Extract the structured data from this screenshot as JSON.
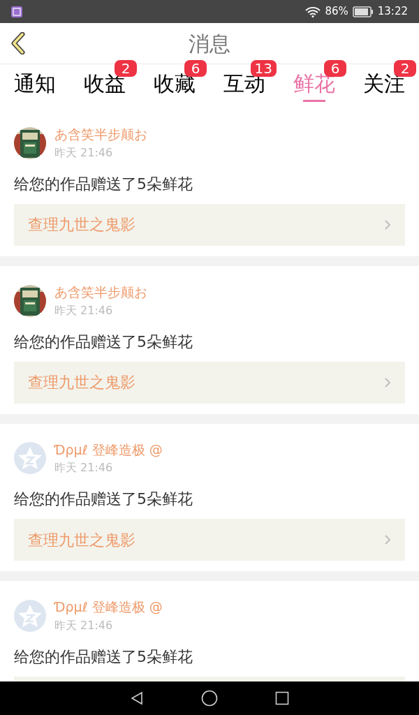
{
  "status_bar": {
    "battery": "86%",
    "time": "13:22"
  },
  "header": {
    "title": "消息"
  },
  "tabs": [
    {
      "label": "通知",
      "selected": false
    },
    {
      "label": "收益",
      "badge": "2",
      "selected": false
    },
    {
      "label": "收藏",
      "badge": "6",
      "selected": false
    },
    {
      "label": "互动",
      "badge": "13",
      "selected": false
    },
    {
      "label": "鲜花",
      "badge": "6",
      "selected": true
    },
    {
      "label": "关注",
      "badge": "2",
      "selected": false
    }
  ],
  "messages": [
    {
      "user": "あ含笑半步颠お",
      "time": "昨天 21:46",
      "text": "给您的作品赠送了5朵鲜花",
      "link": "查理九世之鬼影"
    },
    {
      "user": "あ含笑半步颠お",
      "time": "昨天 21:46",
      "text": "给您的作品赠送了5朵鲜花",
      "link": "查理九世之鬼影"
    },
    {
      "avatar": {
        "kind": "default"
      },
      "user": "Ɗρμℓ 登峰造极 @",
      "time": "昨天 21:46",
      "text": "给您的作品赠送了5朵鲜花",
      "link": "查理九世之鬼影"
    },
    {
      "avatar": {
        "kind": "default"
      },
      "user": "Ɗρμℓ 登峰造极 @",
      "time": "昨天 21:46",
      "text": "给您的作品赠送了5朵鲜花"
    }
  ]
}
